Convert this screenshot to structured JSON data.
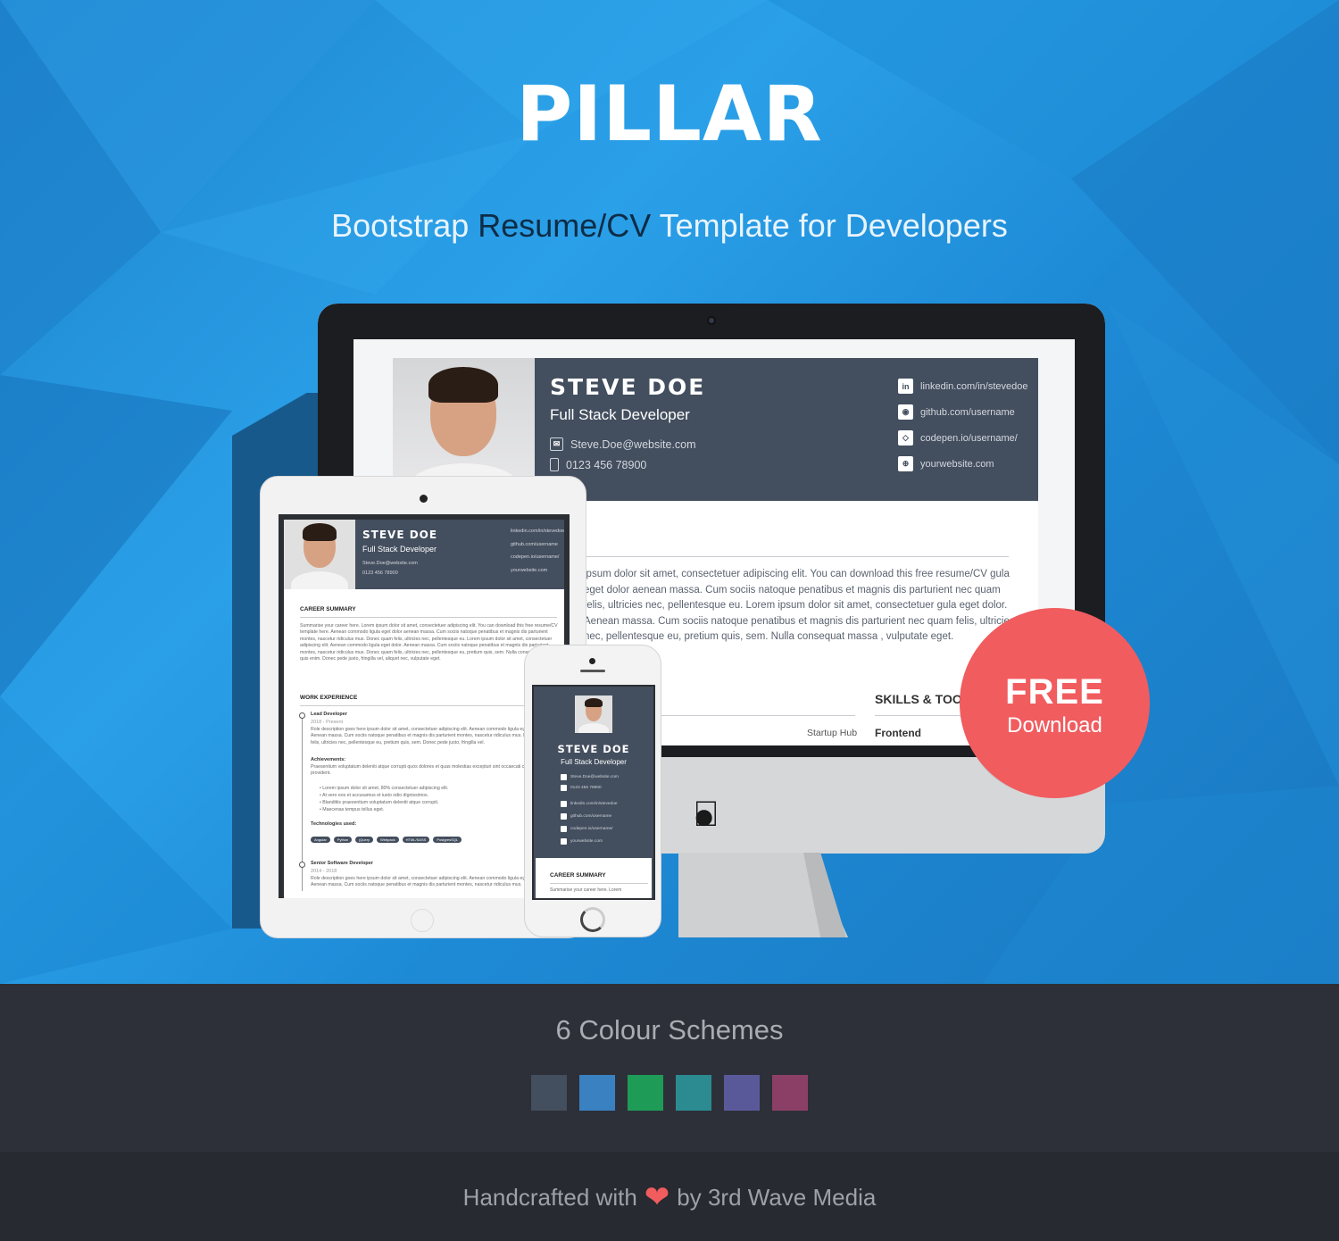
{
  "hero": {
    "title": "PILLAR",
    "subtitle_part1": "Bootstrap ",
    "subtitle_part2": "Resume/CV",
    "subtitle_part3": " Template for Developers"
  },
  "resume": {
    "name": "STEVE DOE",
    "role": "Full Stack Developer",
    "email": "Steve.Doe@website.com",
    "phone": "0123 456 78900",
    "social": [
      {
        "icon": "linkedin-icon",
        "glyph": "in",
        "label": "linkedin.com/in/stevedoe"
      },
      {
        "icon": "github-icon",
        "glyph": "◉",
        "label": "github.com/username"
      },
      {
        "icon": "codepen-icon",
        "glyph": "◇",
        "label": "codepen.io/username/"
      },
      {
        "icon": "globe-icon",
        "glyph": "⊕",
        "label": "yourwebsite.com"
      }
    ],
    "summary_visible": "ipsum dolor sit amet, consectetuer adipiscing elit. You can download this free resume/CV gula eget dolor aenean massa. Cum sociis natoque penatibus et magnis dis parturient nec quam felis, ultricies nec, pellentesque eu. Lorem ipsum dolor sit amet, consectetuer gula eget dolor. Aenean massa. Cum sociis natoque penatibus et magnis dis parturient nec quam felis, ultricies nec, pellentesque eu, pretium quis, sem. Nulla consequat massa , vulputate eget.",
    "skills_heading": "SKILLS & TOOLS",
    "startup_label": "Startup Hub",
    "frontend_label": "Frontend"
  },
  "tablet": {
    "career_heading": "CAREER SUMMARY",
    "career_text": "Summarise your career here. Lorem ipsum dolor sit amet, consectetuer adipiscing elit. You can download this free resume/CV template here. Aenean commodo ligula eget dolor aenean massa. Cum sociis natoque penatibus et magnis dis parturient montes, nascetur ridiculus mus. Donec quam felis, ultricies nec, pellentesque eu. Lorem ipsum dolor sit amet, consectetuer adipiscing elit. Aenean commodo ligula eget dolor. Aenean massa. Cum sociis natoque penatibus et magnis dis parturient montes, nascetur ridiculus mus. Donec quam felis, ultricies nec, pellentesque eu, pretium quis, sem. Nulla consequat massa quis enim. Donec pede justo, fringilla vel, aliquet nec, vulputate eget.",
    "work_heading": "WORK EXPERIENCE",
    "job1_title": "Lead Developer",
    "job1_dates": "2018 - Present",
    "job1_desc": "Role description goes here ipsum dolor sit amet, consectetuer adipiscing elit. Aenean commodo ligula eget dolor. Aenean massa. Cum sociis natoque penatibus et magnis dis parturient montes, nascetur ridiculus mus. Donec quam felis, ultricies nec, pellentesque eu, pretium quis, sem. Donec pede justo, fringilla vel.",
    "achievements_label": "Achievements:",
    "achievements_text": "Praesentium voluptatum deleniti atque corrupti quos dolores et quas molestias excepturi sint occaecati cupiditate non provident.",
    "bullets": [
      "Lorem ipsum dolor sit amet, 80% consectetuer adipiscing elit.",
      "At vero eos et accusamus et iusto odio dignissimos.",
      "Blanditiis praesentium voluptatum deleniti atque corrupti.",
      "Maecenas tempus tellus eget."
    ],
    "tech_label": "Technologies used:",
    "tags": [
      "Angular",
      "Python",
      "jQuery",
      "Webpack",
      "HTML/SASS",
      "PostgresSQL"
    ],
    "job2_title": "Senior Software Developer",
    "job2_dates": "2014 - 2018",
    "job2_desc": "Role description goes here ipsum dolor sit amet, consectetuer adipiscing elit. Aenean commodo ligula eget dolor. Aenean massa. Cum sociis natoque penatibus et magnis dis parturient montes, nascetur ridiculus mus."
  },
  "phone": {
    "career_heading": "CAREER SUMMARY",
    "career_text": "Summarise your career here. Lorem"
  },
  "badge": {
    "line1": "FREE",
    "line2": "Download"
  },
  "schemes": {
    "title": "6 Colour Schemes",
    "colors": [
      "#434e5e",
      "#3a81c2",
      "#1e9b56",
      "#2c8a91",
      "#59599a",
      "#8c3f66"
    ]
  },
  "footer": {
    "text_before": "Handcrafted with",
    "text_after": "by 3rd Wave Media"
  }
}
